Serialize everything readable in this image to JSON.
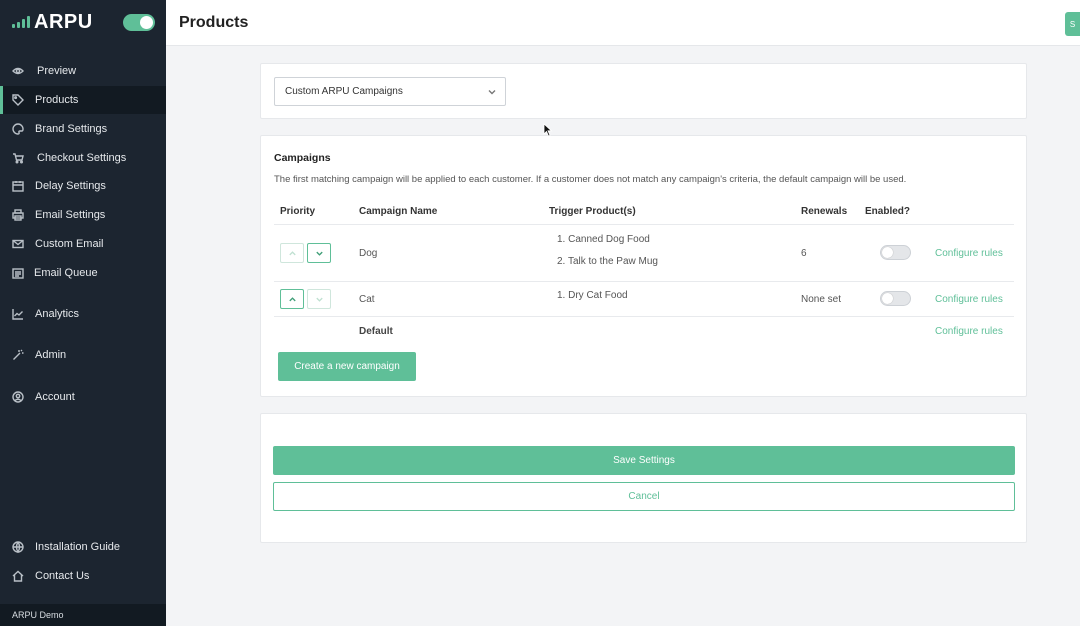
{
  "brand": {
    "name": "ARPU",
    "accent": "#5fbf98"
  },
  "sidebar": {
    "items": [
      {
        "label": "Preview",
        "icon": "eye-icon"
      },
      {
        "label": "Products",
        "icon": "tag-icon",
        "active": true
      },
      {
        "label": "Brand Settings",
        "icon": "palette-icon"
      },
      {
        "label": "Checkout Settings",
        "icon": "cart-icon"
      },
      {
        "label": "Delay Settings",
        "icon": "calendar-icon"
      },
      {
        "label": "Email Settings",
        "icon": "printer-icon"
      },
      {
        "label": "Custom Email",
        "icon": "mail-icon"
      },
      {
        "label": "Email Queue",
        "icon": "calendar-list-icon"
      },
      {
        "label": "Analytics",
        "icon": "chart-icon"
      },
      {
        "label": "Admin",
        "icon": "wand-icon"
      },
      {
        "label": "Account",
        "icon": "user-circle-icon"
      }
    ],
    "bottom_items": [
      {
        "label": "Installation Guide",
        "icon": "globe-icon"
      },
      {
        "label": "Contact Us",
        "icon": "home-icon"
      }
    ],
    "footer": "ARPU Demo"
  },
  "header": {
    "title": "Products",
    "button_label": "S"
  },
  "campaign_select": {
    "value": "Custom ARPU Campaigns"
  },
  "campaigns": {
    "title": "Campaigns",
    "description": "The first matching campaign will be applied to each customer. If a customer does not match any campaign's criteria, the default campaign will be used.",
    "columns": {
      "priority": "Priority",
      "name": "Campaign Name",
      "trigger": "Trigger Product(s)",
      "renewals": "Renewals",
      "enabled": "Enabled?"
    },
    "rows": [
      {
        "name": "Dog",
        "products": [
          "1. Canned Dog Food",
          "2. Talk to the Paw Mug"
        ],
        "renewals": "6",
        "configure": "Configure rules"
      },
      {
        "name": "Cat",
        "products": [
          "1. Dry Cat Food"
        ],
        "renewals": "None set",
        "configure": "Configure rules"
      }
    ],
    "default_row": {
      "name": "Default",
      "configure": "Configure rules"
    },
    "create_label": "Create a new campaign"
  },
  "actions": {
    "save": "Save Settings",
    "cancel": "Cancel"
  }
}
